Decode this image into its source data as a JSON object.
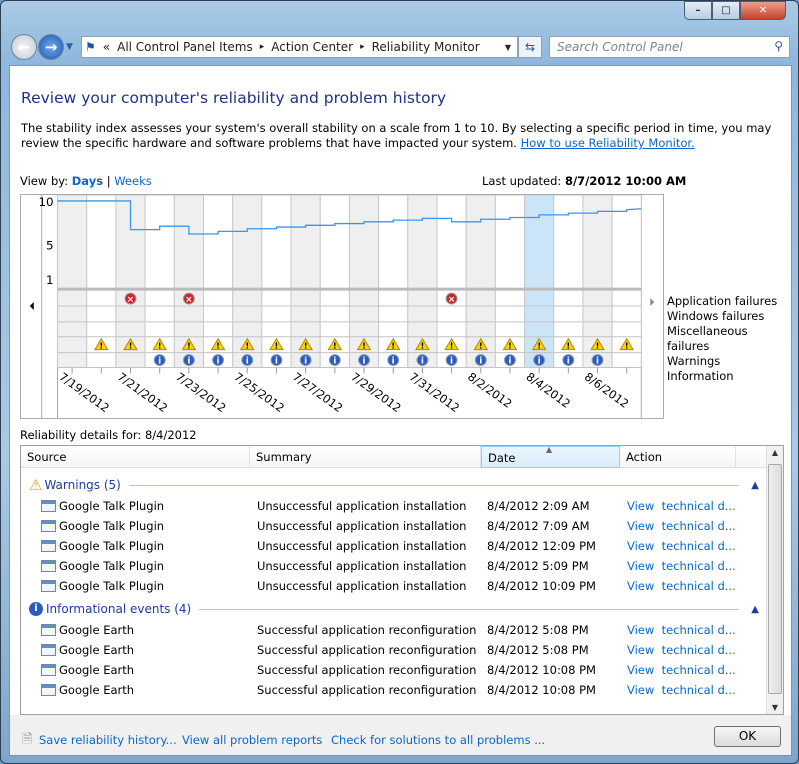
{
  "window": {
    "minimize": "–",
    "maximize": "□",
    "close": "✕"
  },
  "address": {
    "crumbs": [
      "«",
      "All Control Panel Items",
      "▸",
      "Action Center",
      "▸",
      "Reliability Monitor"
    ],
    "search_placeholder": "Search Control Panel"
  },
  "page": {
    "title": "Review your computer's reliability and problem history",
    "description": "The stability index assesses your system's overall stability on a scale from 1 to 10. By selecting a specific period in time, you may review the specific hardware and software problems that have impacted your system.",
    "how_to_link": "How to use Reliability Monitor.",
    "view_by_label": "View by:",
    "view_days": "Days",
    "view_sep": "|",
    "view_weeks": "Weeks",
    "last_updated_label": "Last updated:",
    "last_updated_value": "8/7/2012 10:00 AM",
    "details_label": "Reliability details for: 8/4/2012"
  },
  "chart_data": {
    "type": "line",
    "x": [
      "7/19/2012",
      "7/20/2012",
      "7/21/2012",
      "7/22/2012",
      "7/23/2012",
      "7/24/2012",
      "7/25/2012",
      "7/26/2012",
      "7/27/2012",
      "7/28/2012",
      "7/29/2012",
      "7/30/2012",
      "7/31/2012",
      "8/1/2012",
      "8/2/2012",
      "8/3/2012",
      "8/4/2012",
      "8/5/2012",
      "8/6/2012",
      "8/7/2012"
    ],
    "tick_labels": [
      "7/19/2012",
      "7/21/2012",
      "7/23/2012",
      "7/25/2012",
      "7/27/2012",
      "7/29/2012",
      "7/31/2012",
      "8/2/2012",
      "8/4/2012",
      "8/6/2012"
    ],
    "stability_index": [
      10,
      10,
      6.7,
      7.1,
      6.2,
      6.5,
      6.8,
      7.0,
      7.2,
      7.4,
      7.6,
      7.8,
      8.0,
      7.6,
      7.9,
      8.1,
      8.4,
      8.6,
      8.8,
      9.0
    ],
    "y_ticks": [
      10,
      5,
      1
    ],
    "ylim": [
      1,
      10
    ],
    "selected": "8/4/2012",
    "event_rows": [
      "Application failures",
      "Windows failures",
      "Miscellaneous failures",
      "Warnings",
      "Information"
    ],
    "application_failures": [
      "7/21/2012",
      "7/23/2012",
      "8/1/2012"
    ],
    "windows_failures": [],
    "miscellaneous_failures": [],
    "warnings_from": "7/20/2012",
    "warnings_to": "8/7/2012",
    "information_from": "7/22/2012",
    "information_to": "8/6/2012",
    "colors": {
      "line": "#3d94f0",
      "selected": "#cce4f7",
      "shade": "#efefef",
      "error": "#c8282c",
      "warning": "#f3d21a",
      "info": "#2a5cc0"
    }
  },
  "table": {
    "columns": [
      "Source",
      "Summary",
      "Date",
      "Action"
    ],
    "groups": [
      {
        "title": "Warnings (5)",
        "icon": "warning-icon",
        "rows": [
          {
            "source": "Google Talk Plugin",
            "summary": "Unsuccessful application installation",
            "date": "8/4/2012 2:09 AM",
            "action": "View  technical d..."
          },
          {
            "source": "Google Talk Plugin",
            "summary": "Unsuccessful application installation",
            "date": "8/4/2012 7:09 AM",
            "action": "View  technical d..."
          },
          {
            "source": "Google Talk Plugin",
            "summary": "Unsuccessful application installation",
            "date": "8/4/2012 12:09 PM",
            "action": "View  technical d..."
          },
          {
            "source": "Google Talk Plugin",
            "summary": "Unsuccessful application installation",
            "date": "8/4/2012 5:09 PM",
            "action": "View  technical d..."
          },
          {
            "source": "Google Talk Plugin",
            "summary": "Unsuccessful application installation",
            "date": "8/4/2012 10:09 PM",
            "action": "View  technical d..."
          }
        ]
      },
      {
        "title": "Informational events (4)",
        "icon": "info-icon",
        "rows": [
          {
            "source": "Google Earth",
            "summary": "Successful application reconfiguration",
            "date": "8/4/2012 5:08 PM",
            "action": "View  technical d..."
          },
          {
            "source": "Google Earth",
            "summary": "Successful application reconfiguration",
            "date": "8/4/2012 5:08 PM",
            "action": "View  technical d..."
          },
          {
            "source": "Google Earth",
            "summary": "Successful application reconfiguration",
            "date": "8/4/2012 10:08 PM",
            "action": "View  technical d..."
          },
          {
            "source": "Google Earth",
            "summary": "Successful application reconfiguration",
            "date": "8/4/2012 10:08 PM",
            "action": "View  technical d..."
          }
        ]
      }
    ]
  },
  "footer": {
    "save": "Save reliability history...",
    "view_all": "View all problem reports",
    "check": "Check for solutions to all problems ...",
    "ok": "OK"
  }
}
